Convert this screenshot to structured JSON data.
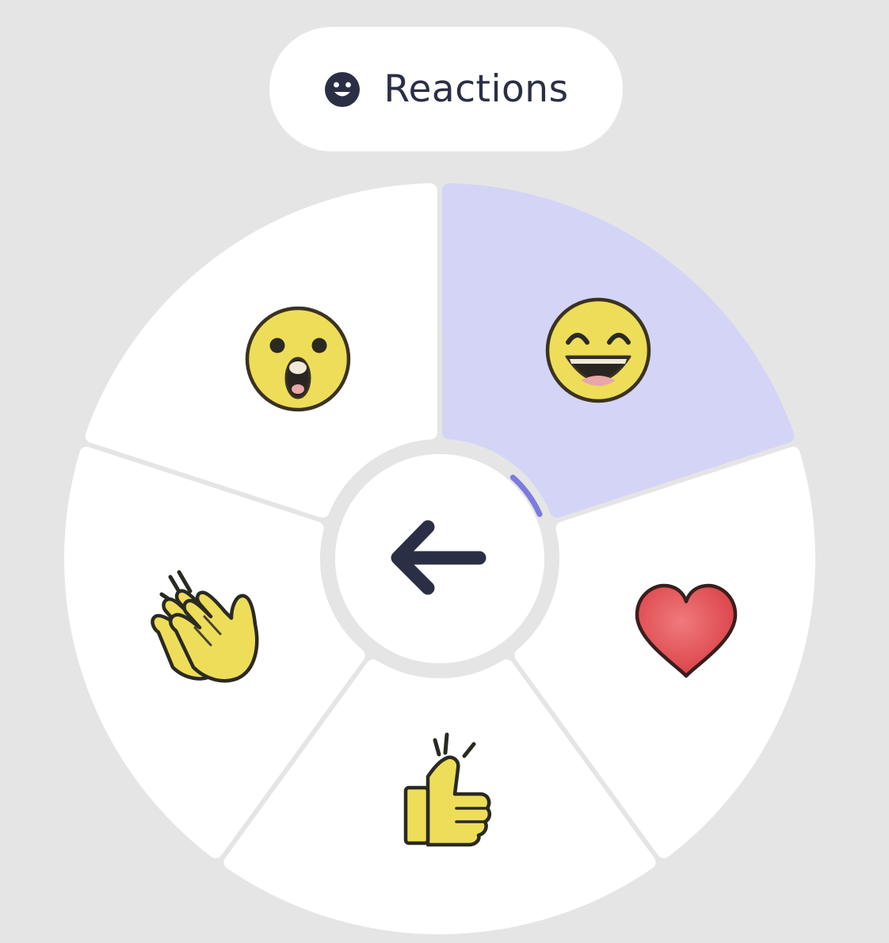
{
  "header": {
    "title": "Reactions",
    "icon": "smiley-face-icon"
  },
  "wheel": {
    "center_button": {
      "icon": "arrow-left-icon",
      "label": "Back"
    },
    "selected_index": 0,
    "items": [
      {
        "id": "laugh",
        "icon": "grinning-squinting-face-icon"
      },
      {
        "id": "heart",
        "icon": "red-heart-icon"
      },
      {
        "id": "thumbs-up",
        "icon": "thumbs-up-icon"
      },
      {
        "id": "clap",
        "icon": "clapping-hands-icon"
      },
      {
        "id": "surprised",
        "icon": "surprised-face-icon"
      }
    ]
  },
  "colors": {
    "background": "#e5e5e5",
    "segment": "#ffffff",
    "selected_segment": "#d4d4f6",
    "selected_accent": "#7b7be0",
    "ink": "#2b2f45",
    "emoji_yellow": "#eedd59",
    "emoji_outline": "#3a3320",
    "heart_red": "#e0474c"
  }
}
